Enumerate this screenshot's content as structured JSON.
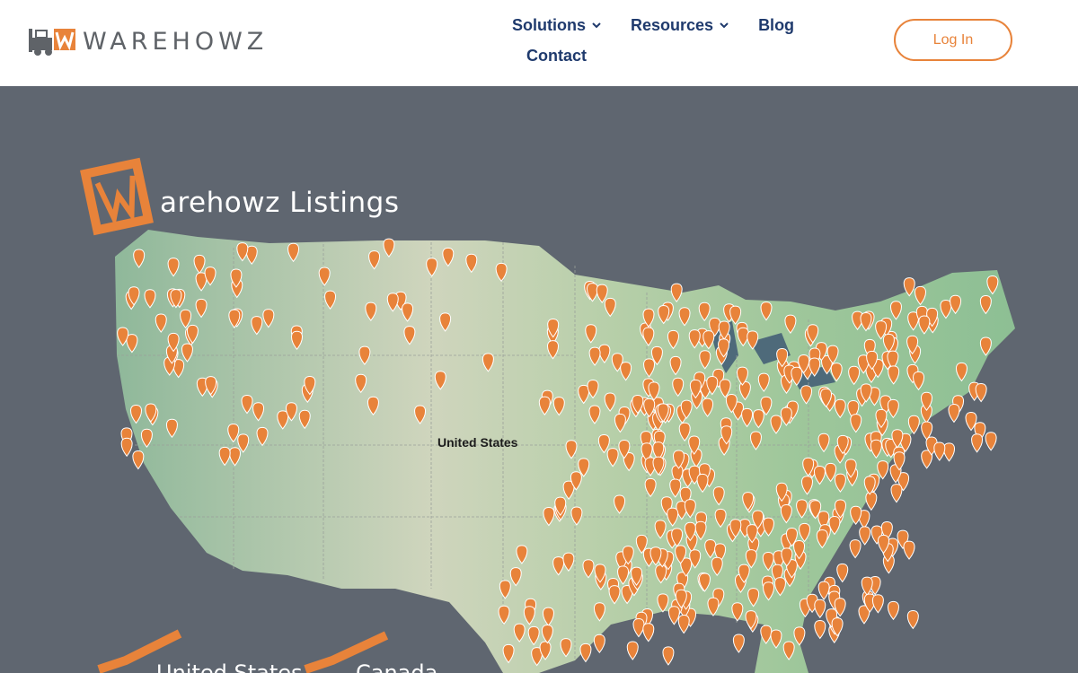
{
  "brand": {
    "name": "WAREHOWZ",
    "accent": "#e8833a",
    "nav_color": "#1f3a6d"
  },
  "nav": {
    "items": [
      {
        "label": "Solutions",
        "dropdown": true
      },
      {
        "label": "Resources",
        "dropdown": true
      },
      {
        "label": "Blog",
        "dropdown": false
      },
      {
        "label": "Contact",
        "dropdown": false
      }
    ],
    "login_label": "Log In"
  },
  "hero": {
    "title": "arehowz Listings",
    "map_label": "United States",
    "bottom_labels": [
      "United States",
      "Canada"
    ],
    "icons": [
      "forklift-icon",
      "location-pin-icon",
      "checkmark-icon"
    ]
  }
}
